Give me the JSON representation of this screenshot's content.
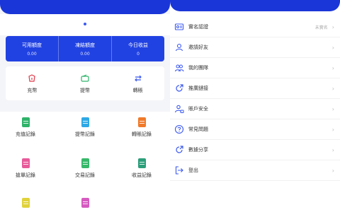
{
  "left": {
    "stats": [
      {
        "label": "可用額度",
        "value": "0.00"
      },
      {
        "label": "凍結額度",
        "value": "0.00"
      },
      {
        "label": "今日收益",
        "value": "0"
      }
    ],
    "actions": [
      {
        "label": "充幣",
        "icon": "deposit-icon"
      },
      {
        "label": "提幣",
        "icon": "withdraw-icon"
      },
      {
        "label": "轉賬",
        "icon": "transfer-icon"
      }
    ],
    "records": [
      {
        "label": "充值記錄",
        "color": "#2fb36a"
      },
      {
        "label": "提幣記錄",
        "color": "#2ea8e6"
      },
      {
        "label": "轉賬記錄",
        "color": "#f07a2a"
      },
      {
        "label": "搶單記錄",
        "color": "#e85a9a"
      },
      {
        "label": "交易記錄",
        "color": "#37b86a"
      },
      {
        "label": "收益記錄",
        "color": "#2c9e7a"
      },
      {
        "label": "",
        "color": "#e0d23a"
      },
      {
        "label": "",
        "color": "#d65ac0"
      }
    ]
  },
  "right": {
    "menu": [
      {
        "label": "實名認證",
        "extra": "未實名",
        "icon": "id-card-icon"
      },
      {
        "label": "邀請好友",
        "extra": "",
        "icon": "user-icon"
      },
      {
        "label": "我的團隊",
        "extra": "",
        "icon": "team-icon"
      },
      {
        "label": "推廣鏈接",
        "extra": "",
        "icon": "share-link-icon"
      },
      {
        "label": "賬戶安全",
        "extra": "",
        "icon": "security-icon"
      },
      {
        "label": "常見問題",
        "extra": "",
        "icon": "help-icon"
      },
      {
        "label": "數據分享",
        "extra": "",
        "icon": "share-icon"
      },
      {
        "label": "登出",
        "extra": "",
        "icon": "logout-icon"
      }
    ]
  },
  "colors": {
    "brand": "#1a36d8",
    "accent": "#2142e2"
  }
}
